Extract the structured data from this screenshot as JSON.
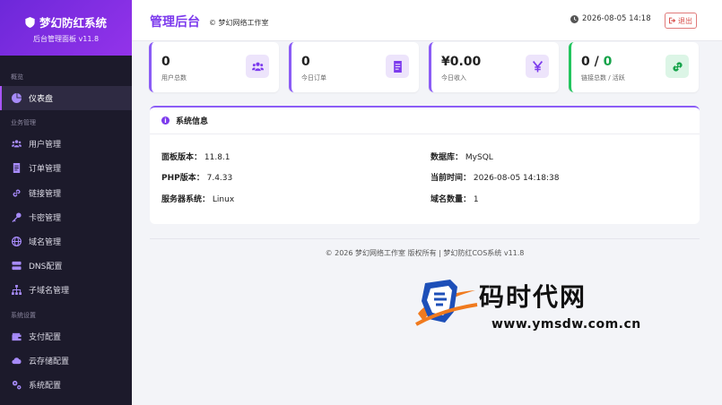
{
  "brand": {
    "title": "梦幻防红系统",
    "subtitle": "后台管理面板 v11.8"
  },
  "sidebar": {
    "section_overview": "概览",
    "section_business": "业务管理",
    "section_settings": "系统设置",
    "items": [
      {
        "label": "仪表盘",
        "icon": "dashboard-icon"
      },
      {
        "label": "用户管理",
        "icon": "users-icon"
      },
      {
        "label": "订单管理",
        "icon": "order-icon"
      },
      {
        "label": "链接管理",
        "icon": "link-icon"
      },
      {
        "label": "卡密管理",
        "icon": "key-icon"
      },
      {
        "label": "域名管理",
        "icon": "globe-icon"
      },
      {
        "label": "DNS配置",
        "icon": "server-icon"
      },
      {
        "label": "子域名管理",
        "icon": "sitemap-icon"
      },
      {
        "label": "支付配置",
        "icon": "wallet-icon"
      },
      {
        "label": "云存储配置",
        "icon": "cloud-icon"
      },
      {
        "label": "系统配置",
        "icon": "cogs-icon"
      }
    ]
  },
  "header": {
    "title": "管理后台",
    "studio": "© 梦幻网络工作室",
    "time": "2026-08-05 14:18",
    "logout": "退出"
  },
  "stats": [
    {
      "value": "0",
      "label": "用户总数",
      "icon": "users-icon"
    },
    {
      "value": "0",
      "label": "今日订单",
      "icon": "order-icon"
    },
    {
      "value": "¥0.00",
      "label": "今日收入",
      "icon": "yen-icon"
    },
    {
      "value_a": "0 / ",
      "value_b": "0",
      "label": "链接总数 / 活跃",
      "icon": "link-icon"
    }
  ],
  "system_info": {
    "title": "系统信息",
    "panel_version_label": "面板版本：",
    "panel_version": "11.8.1",
    "php_label": "PHP版本：",
    "php": "7.4.33",
    "os_label": "服务器系统：",
    "os": "Linux",
    "db_label": "数据库：",
    "db": "MySQL",
    "now_label": "当前时间：",
    "now": "2026-08-05 14:18:38",
    "domains_label": "域名数量：",
    "domains": "1"
  },
  "footer": "© 2026 梦幻网络工作室 版权所有 | 梦幻防红COS系统 v11.8",
  "watermark": {
    "text": "码时代网",
    "url": "www.ymsdw.com.cn"
  },
  "colors": {
    "accent": "#7c3aed",
    "sidebar": "#1c1a2b",
    "success": "#16a34a",
    "danger": "#d9534f"
  }
}
